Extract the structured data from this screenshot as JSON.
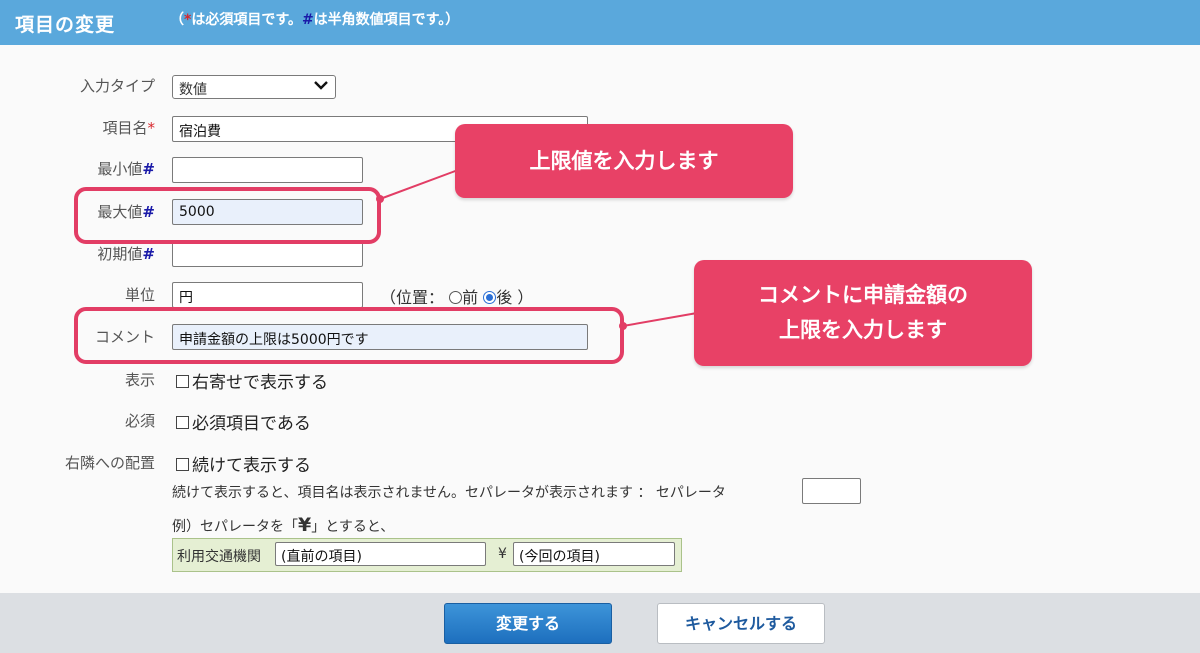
{
  "header": {
    "title": "項目の変更",
    "note_open": "（",
    "note_req_mark": "*",
    "note_mid": "は必須項目です。",
    "note_hash_mark": "#",
    "note_end": "は半角数値項目です。）"
  },
  "form": {
    "input_type": {
      "label": "入力タイプ",
      "value": "数値"
    },
    "item_name": {
      "label": "項目名",
      "required_mark": "*",
      "value": "宿泊費"
    },
    "min_value": {
      "label": "最小値",
      "hash_mark": "#",
      "value": ""
    },
    "max_value": {
      "label": "最大値",
      "hash_mark": "#",
      "value": "5000"
    },
    "initial_value": {
      "label": "初期値",
      "hash_mark": "#",
      "value": ""
    },
    "unit": {
      "label": "単位",
      "value": "円",
      "position_prefix": "（位置：",
      "before_label": "前",
      "after_label": "後",
      "position_suffix": "）",
      "selected": "後"
    },
    "comment": {
      "label": "コメント",
      "value": "申請金額の上限は5000円です"
    },
    "display": {
      "label": "表示",
      "checkbox_label": "右寄せで表示する",
      "checked": false
    },
    "required": {
      "label": "必須",
      "checkbox_label": "必須項目である",
      "checked": false
    },
    "right_placement": {
      "label": "右隣への配置",
      "checkbox_label": "続けて表示する",
      "checked": false
    },
    "separator": {
      "description": "続けて表示すると、項目名は表示されません。セパレータが表示されます ： セパレータ",
      "value": "",
      "example_prefix": "例）セパレータを「",
      "example_yen": "¥",
      "example_suffix": "」とすると、",
      "example_label": "利用交通機関",
      "example_prev": "(直前の項目)",
      "example_yen_char": "¥",
      "example_current": "(今回の項目)"
    }
  },
  "callouts": {
    "max_value_callout": "上限値を入力します",
    "comment_callout_line1": "コメントに申請金額の",
    "comment_callout_line2": "上限を入力します"
  },
  "footer": {
    "submit_label": "変更する",
    "cancel_label": "キャンセルする"
  },
  "colors": {
    "header_bg": "#5aa8dc",
    "callout": "#e84166",
    "required_mark": "#d7272d",
    "primary_button": "#1d6fbe"
  }
}
